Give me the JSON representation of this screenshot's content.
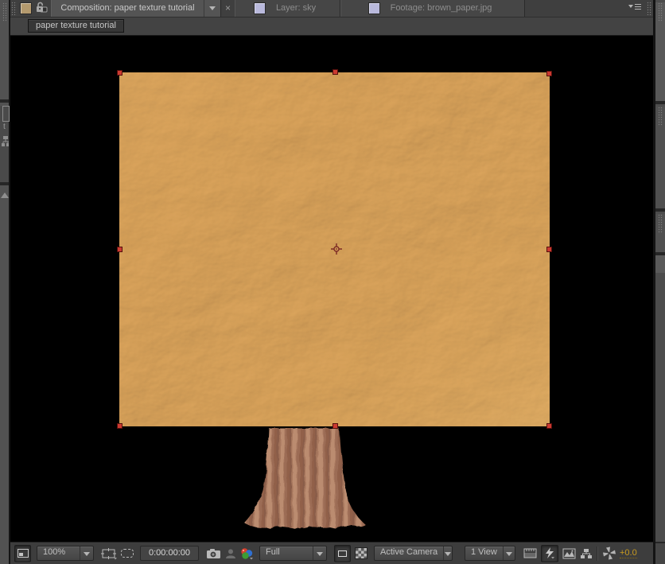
{
  "panel": {
    "kind": "composition viewer",
    "tabs": [
      {
        "label": "Composition: paper texture tutorial",
        "active": true,
        "swatch_color": "#b49a6e"
      },
      {
        "label": "Layer: sky",
        "active": false,
        "swatch_color": "#b9b9dc"
      },
      {
        "label": "Footage: brown_paper.jpg",
        "active": false,
        "swatch_color": "#b9b9dc"
      }
    ]
  },
  "navigator": {
    "breadcrumb": "paper texture tutorial"
  },
  "toolbar": {
    "magnification": "100%",
    "timecode": "0:00:00:00",
    "resolution": "Full",
    "camera_view": "Active Camera",
    "view_layout": "1 View",
    "exposure": "+0.0"
  },
  "icons": {
    "viewer_lock": "unlocked-padlock",
    "tab_dropdown": "chevron-down-triangle",
    "close_glyph": "×",
    "panel_menu": "triangle-plus-menu-lines",
    "always_preview": "monitor-square",
    "grid_guides": "safe-zones-rect",
    "mask_visibility": "dashed-rounded-rect",
    "snapshot": "camera",
    "show_last_snapshot": "person-silhouette",
    "channels": "rgb-circles",
    "region_of_interest": "inner-rect-outline",
    "transparency_grid": "checkerboard",
    "pixel_aspect_ratio": "film-strip",
    "fast_previews": "lightning-bolt",
    "timeline": "framed-photo",
    "flowchart": "node-tree",
    "reset_exposure": "shutter-pinwheel",
    "anchor_point": "crosshair"
  },
  "canvas": {
    "selected_layer_handle_count": 8,
    "layers_visible": [
      "crumpled paper sheet",
      "corrugated cardboard trunk"
    ]
  },
  "colors": {
    "viewport_bg": "#000000",
    "handle_red": "#cb3a31",
    "exposure_text": "#c99b1f",
    "paper_base": "#d9a158",
    "trunk_base": "#a9795f",
    "chrome_bg": "#3f3f3f"
  }
}
